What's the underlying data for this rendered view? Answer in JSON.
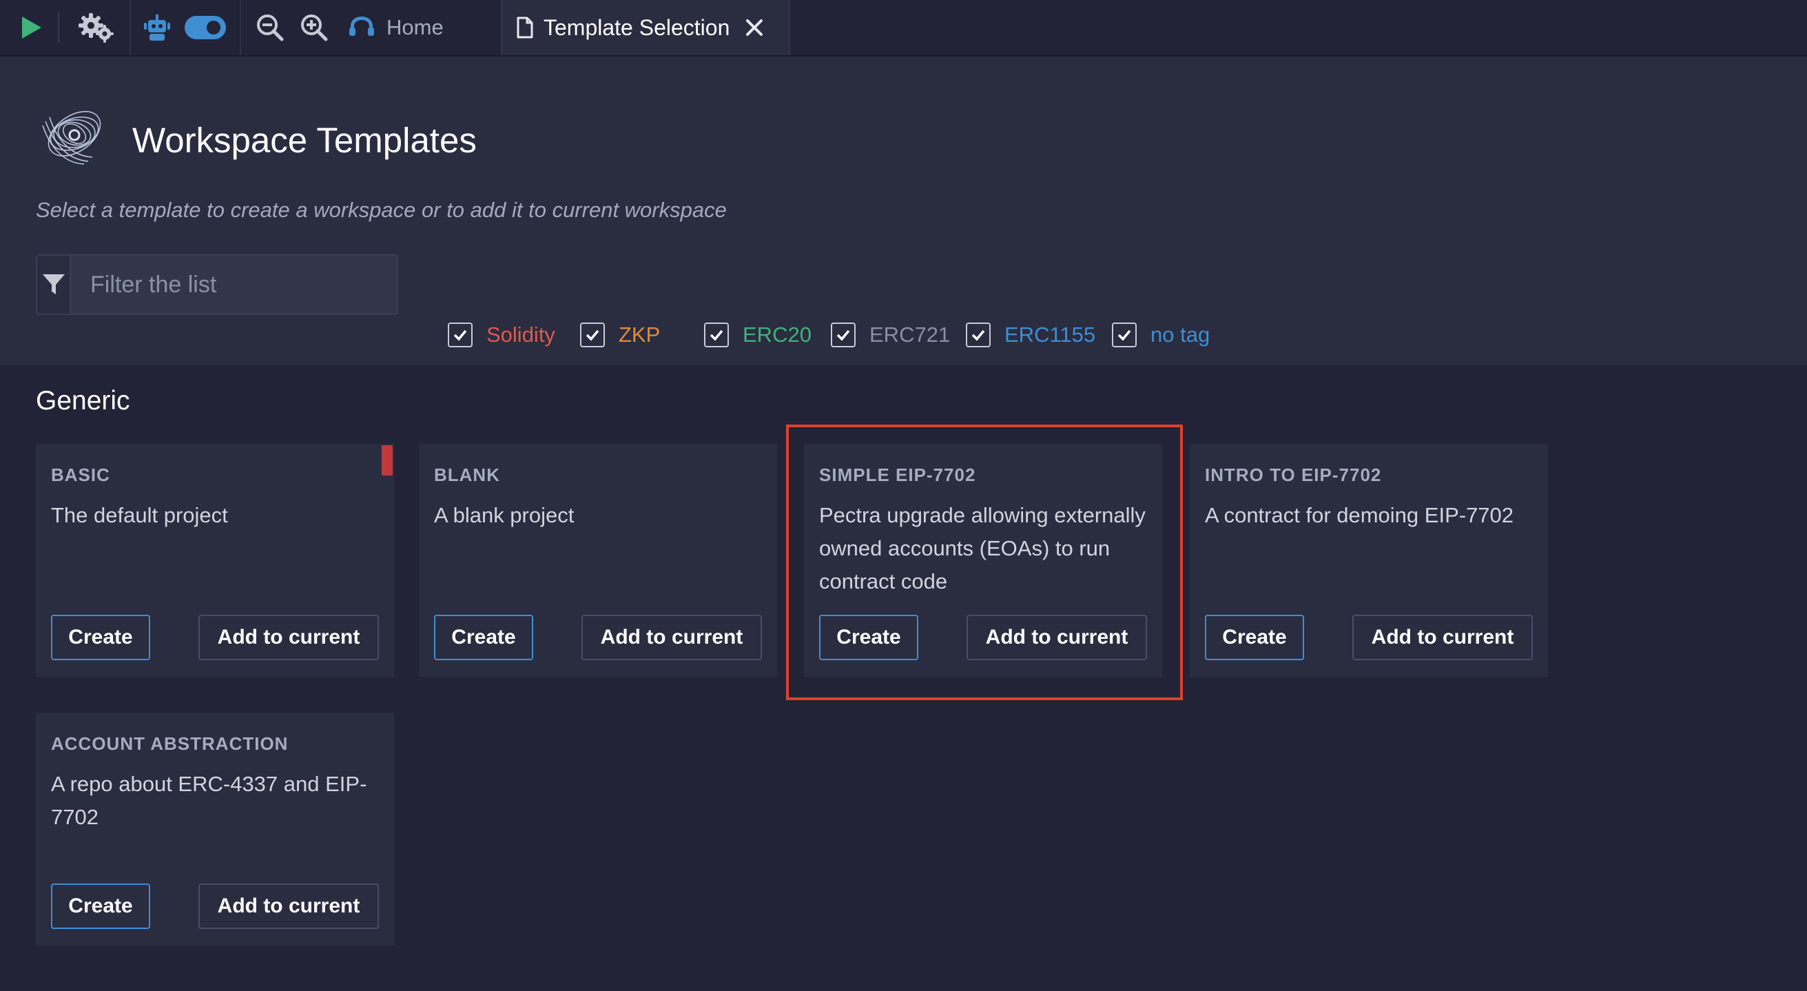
{
  "topbar": {
    "icons": [
      "play-icon",
      "settings-gears-icon",
      "robot-icon",
      "toggle-icon",
      "zoom-out-icon",
      "zoom-in-icon"
    ],
    "home_tab": {
      "label": "Home",
      "icon": "remix-logo-icon"
    },
    "active_tab": {
      "label": "Template Selection",
      "icon": "file-icon",
      "close": "close-icon"
    }
  },
  "header": {
    "title": "Workspace Templates",
    "subtitle": "Select a template to create a workspace or to add it to current workspace",
    "filter": {
      "placeholder": "Filter the list",
      "value": ""
    },
    "tags": [
      {
        "label": "Solidity",
        "checked": true,
        "color": "#e2584d"
      },
      {
        "label": "ZKP",
        "checked": true,
        "color": "#e08a3c"
      },
      {
        "label": "ERC20",
        "checked": true,
        "color": "#3fb37a"
      },
      {
        "label": "ERC721",
        "checked": true,
        "color": "#8b8fa3"
      },
      {
        "label": "ERC1155",
        "checked": true,
        "color": "#3f8ed2"
      },
      {
        "label": "no tag",
        "checked": true,
        "color": "#3f8ed2"
      }
    ]
  },
  "sections": [
    {
      "title": "Generic",
      "cards": [
        {
          "title": "BASIC",
          "description": "The default project",
          "create_label": "Create",
          "add_label": "Add to current"
        },
        {
          "title": "BLANK",
          "description": "A blank project",
          "create_label": "Create",
          "add_label": "Add to current"
        },
        {
          "title": "SIMPLE EIP-7702",
          "description": "Pectra upgrade allowing externally owned accounts (EOAs) to run contract code",
          "create_label": "Create",
          "add_label": "Add to current"
        },
        {
          "title": "INTRO TO EIP-7702",
          "description": "A contract for demoing EIP-7702",
          "create_label": "Create",
          "add_label": "Add to current"
        },
        {
          "title": "ACCOUNT ABSTRACTION",
          "description": "A repo about ERC-4337 and EIP-7702",
          "create_label": "Create",
          "add_label": "Add to current"
        }
      ]
    }
  ],
  "colors": {
    "accent": "#3f8ed2",
    "highlight": "#e0412d",
    "background": "#222336",
    "panel": "#2a2c40"
  }
}
